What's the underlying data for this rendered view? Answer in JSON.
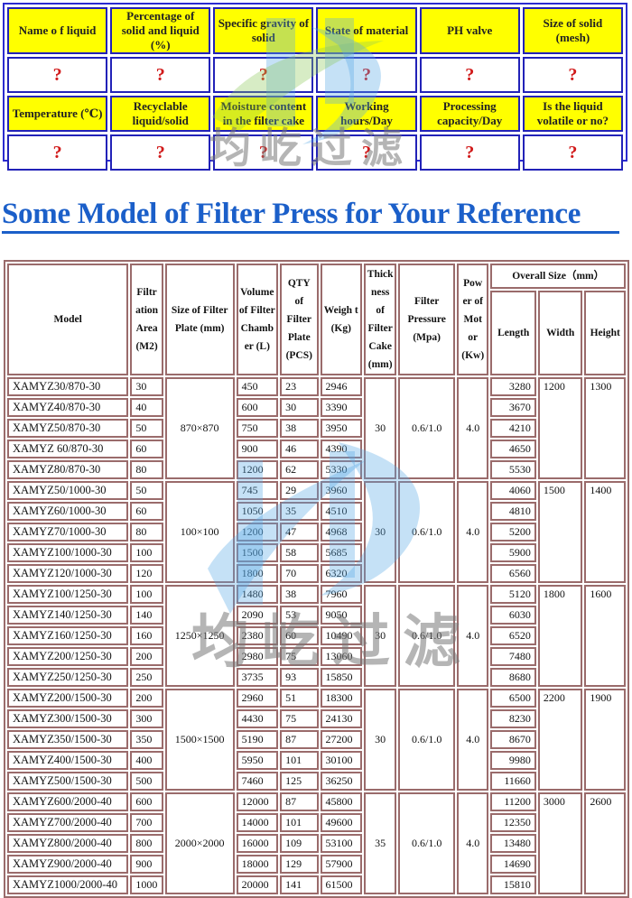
{
  "inquiry": {
    "rows": [
      {
        "type": "header",
        "cells": [
          "Name o f liquid",
          "Percentage of solid and liquid (%)",
          "Specific gravity of solid",
          "State of material",
          "PH valve",
          "Size of solid (mesh)"
        ]
      },
      {
        "type": "answer",
        "cells": [
          "?",
          "?",
          "?",
          "?",
          "?",
          "?"
        ]
      },
      {
        "type": "header",
        "cells": [
          "Temperature (℃)",
          "Recyclable liquid/solid",
          "Moisture content in the filter cake",
          "Working hours/Day",
          "Processing capacity/Day",
          "Is the liquid volatile or no?"
        ]
      },
      {
        "type": "answer",
        "cells": [
          "?",
          "?",
          "?",
          "?",
          "?",
          "?"
        ]
      }
    ]
  },
  "heading": "Some Model of Filter Press for Your Reference",
  "watermark": {
    "text": "均屹过滤"
  },
  "spec_table": {
    "headers": {
      "model": "Model",
      "area": "Filtr ation Area (M2)",
      "plate_size": "Size of Filter Plate (mm)",
      "volume": "Volume of Filter Chamb er (L)",
      "qty": "QTY of Filter Plate (PCS)",
      "weight": "Weigh t (Kg)",
      "thickness": "Thick ness of Filter Cake (mm)",
      "pressure": "Filter Pressure (Mpa)",
      "power": "Pow er of Mot or (Kw)",
      "overall": "Overall Size（mm）",
      "length": "Length",
      "width": "Width",
      "height": "Height"
    },
    "groups": [
      {
        "plate_size": "870×870",
        "thickness": "30",
        "pressure": "0.6/1.0",
        "power": "4.0",
        "width": "1200",
        "height": "1300",
        "rows": [
          {
            "model": "XAMYZ30/870-30",
            "area": "30",
            "volume": "450",
            "qty": "23",
            "weight": "2946",
            "length": "3280"
          },
          {
            "model": "XAMYZ40/870-30",
            "area": "40",
            "volume": "600",
            "qty": "30",
            "weight": "3390",
            "length": "3670"
          },
          {
            "model": "XAMYZ50/870-30",
            "area": "50",
            "volume": "750",
            "qty": "38",
            "weight": "3950",
            "length": "4210"
          },
          {
            "model": "XAMYZ 60/870-30",
            "area": "60",
            "volume": "900",
            "qty": "46",
            "weight": "4390",
            "length": "4650"
          },
          {
            "model": "XAMYZ80/870-30",
            "area": "80",
            "volume": "1200",
            "qty": "62",
            "weight": "5330",
            "length": "5530"
          }
        ]
      },
      {
        "plate_size": "100×100",
        "thickness": "30",
        "pressure": "0.6/1.0",
        "power": "4.0",
        "width": "1500",
        "height": "1400",
        "rows": [
          {
            "model": "XAMYZ50/1000-30",
            "area": "50",
            "volume": "745",
            "qty": "29",
            "weight": "3960",
            "length": "4060"
          },
          {
            "model": "XAMYZ60/1000-30",
            "area": "60",
            "volume": "1050",
            "qty": "35",
            "weight": "4510",
            "length": "4810"
          },
          {
            "model": "XAMYZ70/1000-30",
            "area": "80",
            "volume": "1200",
            "qty": "47",
            "weight": "4968",
            "length": "5200"
          },
          {
            "model": "XAMYZ100/1000-30",
            "area": "100",
            "volume": "1500",
            "qty": "58",
            "weight": "5685",
            "length": "5900"
          },
          {
            "model": "XAMYZ120/1000-30",
            "area": "120",
            "volume": "1800",
            "qty": "70",
            "weight": "6320",
            "length": "6560"
          }
        ]
      },
      {
        "plate_size": "1250×1250",
        "thickness": "30",
        "pressure": "0.6/1.0",
        "power": "4.0",
        "width": "1800",
        "height": "1600",
        "rows": [
          {
            "model": "XAMYZ100/1250-30",
            "area": "100",
            "volume": "1480",
            "qty": "38",
            "weight": "7960",
            "length": "5120"
          },
          {
            "model": "XAMYZ140/1250-30",
            "area": "140",
            "volume": "2090",
            "qty": "53",
            "weight": "9050",
            "length": "6030"
          },
          {
            "model": "XAMYZ160/1250-30",
            "area": "160",
            "volume": "2380",
            "qty": "60",
            "weight": "10490",
            "length": "6520"
          },
          {
            "model": "XAMYZ200/1250-30",
            "area": "200",
            "volume": "2980",
            "qty": "75",
            "weight": "13060",
            "length": "7480"
          },
          {
            "model": "XAMYZ250/1250-30",
            "area": "250",
            "volume": "3735",
            "qty": "93",
            "weight": "15850",
            "length": "8680"
          }
        ]
      },
      {
        "plate_size": "1500×1500",
        "thickness": "30",
        "pressure": "0.6/1.0",
        "power": "4.0",
        "width": "2200",
        "height": "1900",
        "rows": [
          {
            "model": "XAMYZ200/1500-30",
            "area": "200",
            "volume": "2960",
            "qty": "51",
            "weight": "18300",
            "length": "6500"
          },
          {
            "model": "XAMYZ300/1500-30",
            "area": "300",
            "volume": "4430",
            "qty": "75",
            "weight": "24130",
            "length": "8230"
          },
          {
            "model": "XAMYZ350/1500-30",
            "area": "350",
            "volume": "5190",
            "qty": "87",
            "weight": "27200",
            "length": "8670"
          },
          {
            "model": "XAMYZ400/1500-30",
            "area": "400",
            "volume": "5950",
            "qty": "101",
            "weight": "30100",
            "length": "9980"
          },
          {
            "model": "XAMYZ500/1500-30",
            "area": "500",
            "volume": "7460",
            "qty": "125",
            "weight": "36250",
            "length": "11660"
          }
        ]
      },
      {
        "plate_size": "2000×2000",
        "thickness": "35",
        "pressure": "0.6/1.0",
        "power": "4.0",
        "width": "3000",
        "height": "2600",
        "rows": [
          {
            "model": "XAMYZ600/2000-40",
            "area": "600",
            "volume": "12000",
            "qty": "87",
            "weight": "45800",
            "length": "11200"
          },
          {
            "model": "XAMYZ700/2000-40",
            "area": "700",
            "volume": "14000",
            "qty": "101",
            "weight": "49600",
            "length": "12350"
          },
          {
            "model": "XAMYZ800/2000-40",
            "area": "800",
            "volume": "16000",
            "qty": "109",
            "weight": "53100",
            "length": "13480"
          },
          {
            "model": "XAMYZ900/2000-40",
            "area": "900",
            "volume": "18000",
            "qty": "129",
            "weight": "57900",
            "length": "14690"
          },
          {
            "model": "XAMYZ1000/2000-40",
            "area": "1000",
            "volume": "20000",
            "qty": "141",
            "weight": "61500",
            "length": "15810"
          }
        ]
      }
    ]
  }
}
